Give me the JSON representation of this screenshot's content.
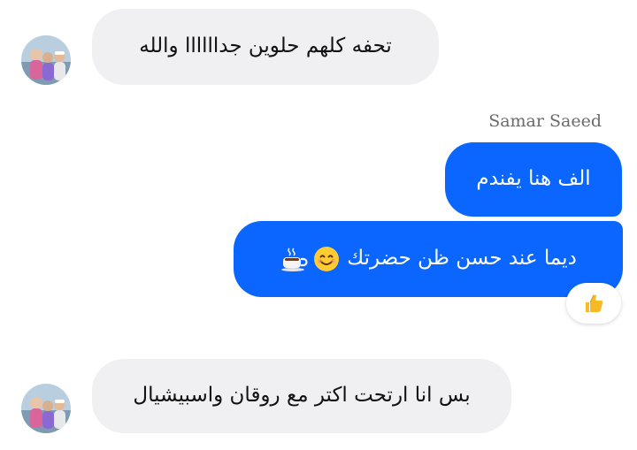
{
  "conversation": {
    "messages": [
      {
        "direction": "incoming",
        "text": "تحفه كلهم حلوين جداااااا والله"
      },
      {
        "direction": "outgoing",
        "sender": "Samar Saeed",
        "text": "الف هنا يفندم"
      },
      {
        "direction": "outgoing",
        "text": "ديما عند حسن ظن حضرتك",
        "emojis": [
          "smiling-face-icon",
          "hot-beverage-icon"
        ],
        "reaction": "thumbs-up-icon"
      },
      {
        "direction": "incoming",
        "text": "بس انا ارتحت اكتر مع روقان واسبيشيال"
      }
    ]
  },
  "colors": {
    "outgoing_bubble": "#0a66ff",
    "incoming_bubble": "#f0f0f2",
    "sender_name": "#6b6b6b",
    "reaction_emoji": "#f7b928"
  }
}
